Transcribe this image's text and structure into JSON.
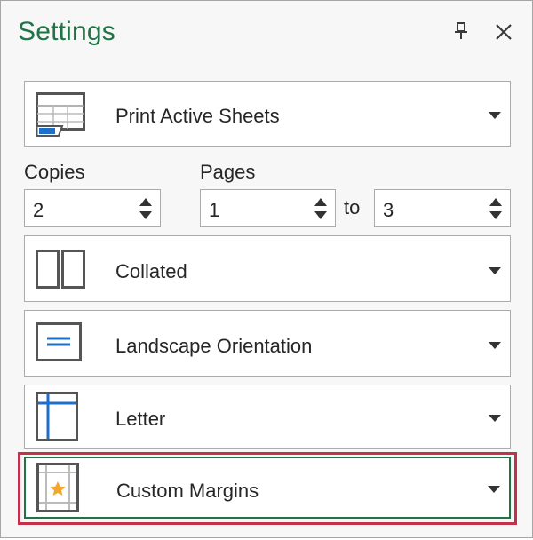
{
  "header": {
    "title": "Settings",
    "pin_icon": "pin-icon",
    "close_icon": "close-icon"
  },
  "print_what": {
    "label": "Print Active Sheets",
    "icon": "sheet-grid-icon"
  },
  "copies": {
    "label": "Copies",
    "value": "2"
  },
  "pages": {
    "label": "Pages",
    "from_value": "1",
    "to_label": "to",
    "to_value": "3"
  },
  "collation": {
    "label": "Collated",
    "icon": "collated-pages-icon"
  },
  "orientation": {
    "label": "Landscape Orientation",
    "icon": "landscape-orientation-icon"
  },
  "paper_size": {
    "label": "Letter",
    "icon": "letter-paper-icon"
  },
  "margins": {
    "label": "Custom Margins",
    "icon": "custom-margins-icon"
  },
  "colors": {
    "accent_green": "#217346",
    "highlight_red": "#c4314b",
    "icon_blue": "#1e6fc7",
    "icon_gray": "#555555",
    "star_gold": "#f3a72b"
  }
}
